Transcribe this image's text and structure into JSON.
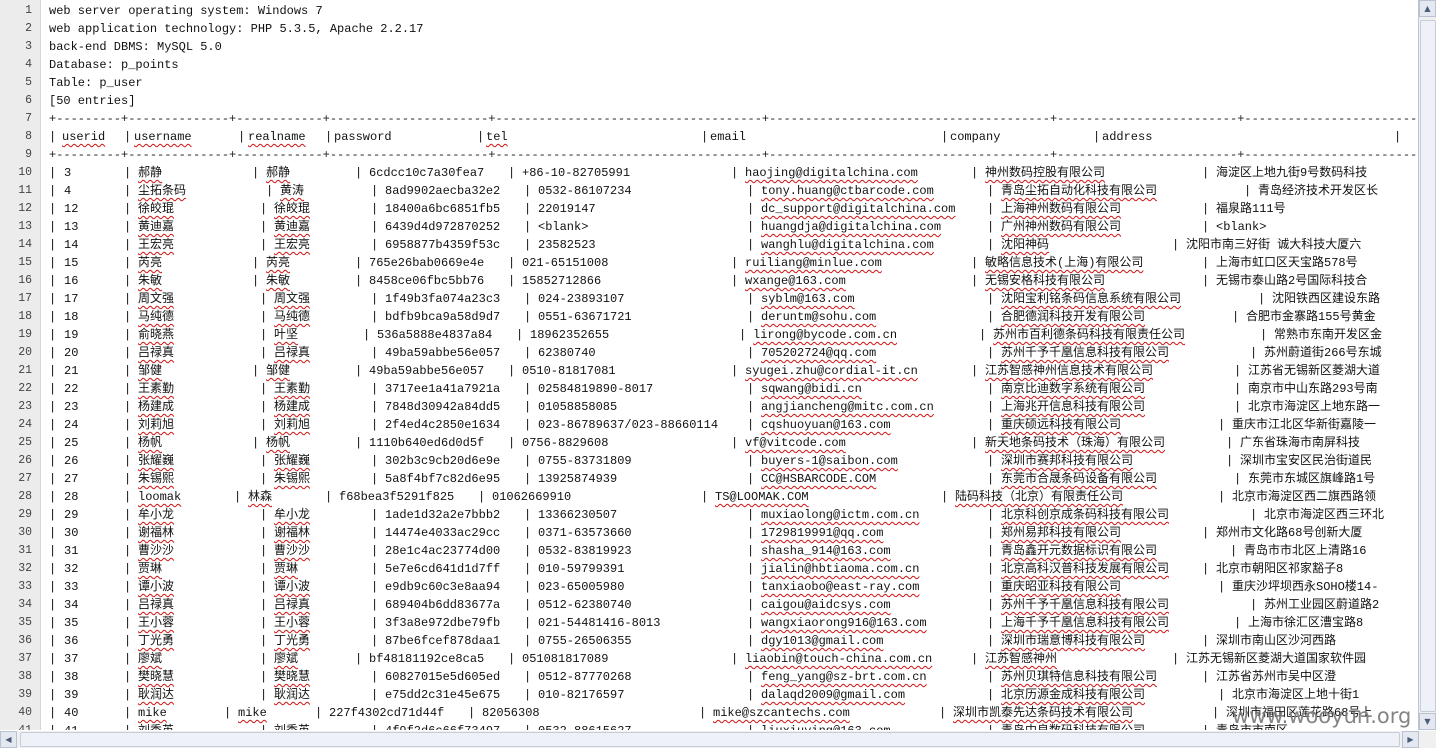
{
  "header_lines": [
    "web server operating system: Windows 7",
    "web application technology: PHP 5.3.5, Apache 2.2.17",
    "back-end DBMS: MySQL 5.0",
    "Database: p_points",
    "Table: p_user",
    "[50 entries]"
  ],
  "separator": "+---------+--------------+------------+----------------------+-------------------------------------+---------------------------------------+-------------------------+-----------------------------------------------------+",
  "columns": [
    "userid",
    "username",
    "realname",
    "password",
    "tel",
    "email",
    "company",
    "address"
  ],
  "rows": [
    [
      "3",
      "郝静",
      "郝静",
      "6cdcc10c7a30fea7",
      "+86-10-82705991",
      "haojing@digitalchina.com",
      "神州数码控股有限公司",
      "海淀区上地九街9号数码科技"
    ],
    [
      "4",
      "尘拓条码",
      "黄涛",
      "8ad9902aecba32e2",
      "0532-86107234",
      "tony.huang@ctbarcode.com",
      "青岛尘拓自动化科技有限公司",
      "青岛经济技术开发区长"
    ],
    [
      "12",
      "徐皎琨",
      "徐皎琨",
      "18400a6bc6851fb5",
      "22019147",
      "dc_support@digitalchina.com",
      "上海神州数码有限公司",
      "福泉路111号"
    ],
    [
      "13",
      "黄迪嘉",
      "黄迪嘉",
      "6439d4d972870252",
      "<blank>",
      "huangdja@digitalchina.com",
      "广州神州数码有限公司",
      "<blank>"
    ],
    [
      "14",
      "王宏亮",
      "王宏亮",
      "6958877b4359f53c",
      "23582523",
      "wanghlu@digitalchina.com",
      "沈阳神码",
      "沈阳市南三好街 诚大科技大厦六"
    ],
    [
      "15",
      "芮亮",
      "芮亮",
      "765e26bab0669e4e",
      "021-65151008",
      "ruiliang@minlue.com",
      "敏略信息技术(上海)有限公司",
      "上海市虹口区天宝路578号"
    ],
    [
      "16",
      "朱敏",
      "朱敏",
      "8458ce06fbc5bb76",
      "15852712866",
      "wxange@163.com",
      "无锡安格科技有限公司",
      "无锡市泰山路2号国际科技合"
    ],
    [
      "17",
      "周文强",
      "周文强",
      "1f49b3fa074a23c3",
      "024-23893107",
      "syblm@163.com",
      "沈阳宝利铭条码信息系统有限公司",
      "沈阳铁西区建设东路"
    ],
    [
      "18",
      "马纯德",
      "马纯德",
      "bdfb9bca9a58d9d7",
      "0551-63671721",
      "deruntm@sohu.com",
      "合肥德润科技开发有限公司",
      "合肥市金寨路155号黄金"
    ],
    [
      "19",
      "俞晓燕",
      "叶坚",
      "536a5888e4837a84",
      "18962352655",
      "lirong@bycode.com.cn",
      "苏州市百利德条码科技有限责任公司",
      "常熟市东南开发区金"
    ],
    [
      "20",
      "吕禄真",
      "吕禄真",
      "49ba59abbe56e057",
      "62380740",
      "705202724@qq.com",
      "苏州千予千凰信息科技有限公司",
      "苏州蔚道街266号东城"
    ],
    [
      "21",
      "邹健",
      "邹健",
      "49ba59abbe56e057",
      "0510-81817081",
      "syugei.zhu@cordial-it.cn",
      "江苏智感神州信息技术有限公司",
      "江苏省无锡新区菱湖大道"
    ],
    [
      "22",
      "王素勤",
      "王素勤",
      "3717ee1a41a7921a",
      "02584819890-8017",
      "sqwang@bidi.cn",
      "南京比迪数字系统有限公司",
      "南京市中山东路293号南"
    ],
    [
      "23",
      "杨建成",
      "杨建成",
      "7848d30942a84dd5",
      "01058858085",
      "angjiancheng@mitc.com.cn",
      "上海兆开信息科技有限公司",
      "北京市海淀区上地东路一"
    ],
    [
      "24",
      "刘莉旭",
      "刘莉旭",
      "2f4ed4c2850e1634",
      "023-86789637/023-88660114",
      "cqshuoyuan@163.com",
      "重庆硕远科技有限公司",
      "重庆市江北区华新街嘉陵一"
    ],
    [
      "25",
      "杨帆",
      "杨帆",
      "1110b640ed6d0d5f",
      "0756-8829608",
      "vf@vitcode.com",
      "新天地条码技术（珠海）有限公司",
      "广东省珠海市南屏科技"
    ],
    [
      "26",
      "张耀巍",
      "张耀巍",
      "302b3c9cb20d6e9e",
      "0755-83731809",
      "buyers-1@saibon.com",
      "深圳市赛邦科技有限公司",
      "深圳市宝安区民治街道民"
    ],
    [
      "27",
      "朱锡熙",
      "朱锡熙",
      "5a8f4bf7c82d6e95",
      "13925874939",
      "CC@HSBARCODE.COM",
      "东莞市合晟条码设备有限公司",
      "东莞市东城区旗峰路1号"
    ],
    [
      "28",
      "loomak",
      "林森",
      "f68bea3f5291f825",
      "01062669910",
      "TS@LOOMAK.COM",
      "陆码科技（北京）有限责任公司",
      "北京市海淀区西二旗西路领"
    ],
    [
      "29",
      "牟小龙",
      "牟小龙",
      "1ade1d32a2e7bbb2",
      "13366230507",
      "muxiaolong@ictm.com.cn",
      "北京科创京成条码科技有限公司",
      "北京市海淀区西三环北"
    ],
    [
      "30",
      "谢福林",
      "谢福林",
      "14474e4033ac29cc",
      "0371-63573660",
      "1729819991@qq.com",
      "郑州易邦科技有限公司",
      "郑州市文化路68号创新大厦"
    ],
    [
      "31",
      "曹沙沙",
      "曹沙沙",
      "28e1c4ac23774d00",
      "0532-83819923",
      "shasha_914@163.com",
      "青岛鑫开元数据标识有限公司",
      "青岛市市北区上清路16"
    ],
    [
      "32",
      "贾琳",
      "贾琳",
      "5e7e6cd641d1d7ff",
      "010-59799391",
      "jialin@hbtiaoma.com.cn",
      "北京高科汉普科技发展有限公司",
      "北京市朝阳区祁家豁子8"
    ],
    [
      "33",
      "谭小波",
      "谭小波",
      "e9db9c60c3e8aa94",
      "023-65005980",
      "tanxiaobo@east-ray.com",
      "重庆昭亚科技有限公司",
      "重庆沙坪坝西永SOHO楼14-"
    ],
    [
      "34",
      "吕禄真",
      "吕禄真",
      "689404b6dd83677a",
      "0512-62380740",
      "caigou@aidcsys.com",
      "苏州千予千凰信息科技有限公司",
      "苏州工业园区蔚道路2"
    ],
    [
      "35",
      "王小蓉",
      "王小蓉",
      "3f3a8e972dbe79fb",
      "021-54481416-8013",
      "wangxiaorong916@163.com",
      "上海千予千凰信息科技有限公司",
      "上海市徐汇区漕宝路8"
    ],
    [
      "36",
      "丁光勇",
      "丁光勇",
      "87be6fcef878daa1",
      "0755-26506355",
      "dgy1013@gmail.com",
      "深圳市瑞意博科技有限公司",
      "深圳市南山区沙河西路"
    ],
    [
      "37",
      "廖斌",
      "廖斌",
      "bf48181192ce8ca5",
      "051081817089",
      "liaobin@touch-china.com.cn",
      "江苏智感神州",
      "江苏无锡新区菱湖大道国家软件园"
    ],
    [
      "38",
      "樊晓慧",
      "樊晓慧",
      "60827015e5d605ed",
      "0512-87770268",
      "feng_yang@sz-brt.com.cn",
      "苏州贝琪特信息科技有限公司",
      "江苏省苏州市吴中区澄"
    ],
    [
      "39",
      "耿润达",
      "耿润达",
      "e75dd2c31e45e675",
      "010-82176597",
      "dalaqd2009@gmail.com",
      "北京历源金成科技有限公司",
      "北京市海淀区上地十街1"
    ],
    [
      "40",
      "mike",
      "mike",
      "227f4302cd71d44f",
      "82056308",
      "mike@szcantechs.com",
      "深圳市凯泰先达条码技术有限公司",
      "深圳市福田区莲花路68号上"
    ],
    [
      "41",
      "刘秀英",
      "刘秀英",
      "4f9f2d6c66f73497",
      "0532-88615627",
      "liuxiuying@163.com",
      "青岛中良数码科技有限公司",
      "青岛市市南区"
    ]
  ],
  "watermark": "www.wooyun.org",
  "scrollbar": {
    "up_icon": "arrow-up-icon",
    "down_icon": "arrow-down-icon",
    "left_icon": "arrow-left-icon",
    "right_icon": "arrow-right-icon"
  },
  "colors": {
    "background": "#ffffff",
    "gutter": "#ececec",
    "spellcheck_underline": "#d01010",
    "scrollbar": "#f0f0f0"
  }
}
